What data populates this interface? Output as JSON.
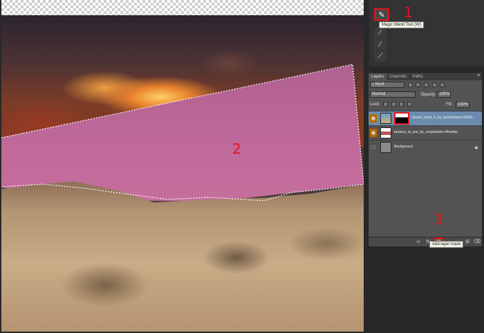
{
  "annotations": {
    "n1": "1",
    "n2": "2",
    "n3": "3"
  },
  "tools": {
    "wand_icon": "magic-wand-icon",
    "wand_tooltip": "Magic Wand Tool (W)"
  },
  "layers_panel": {
    "tabs": [
      "Layers",
      "Channels",
      "Paths"
    ],
    "kind_label": "Kind",
    "blend_mode": "Normal",
    "opacity_label": "Opacity:",
    "opacity_value": "100%",
    "lock_label": "Lock:",
    "fill_label": "Fill:",
    "fill_value": "100%",
    "layers": [
      {
        "name": "desert_stock_3_by_humblebees-d32bn..."
      },
      {
        "name": "tartarus_at_war_by_cnquistador-d4ewlqq"
      },
      {
        "name": "Background"
      }
    ],
    "add_mask_tooltip": "Add layer mask"
  },
  "colors": {
    "highlight": "#e3141a",
    "panel": "#535353",
    "selection": "#c06a9a"
  }
}
